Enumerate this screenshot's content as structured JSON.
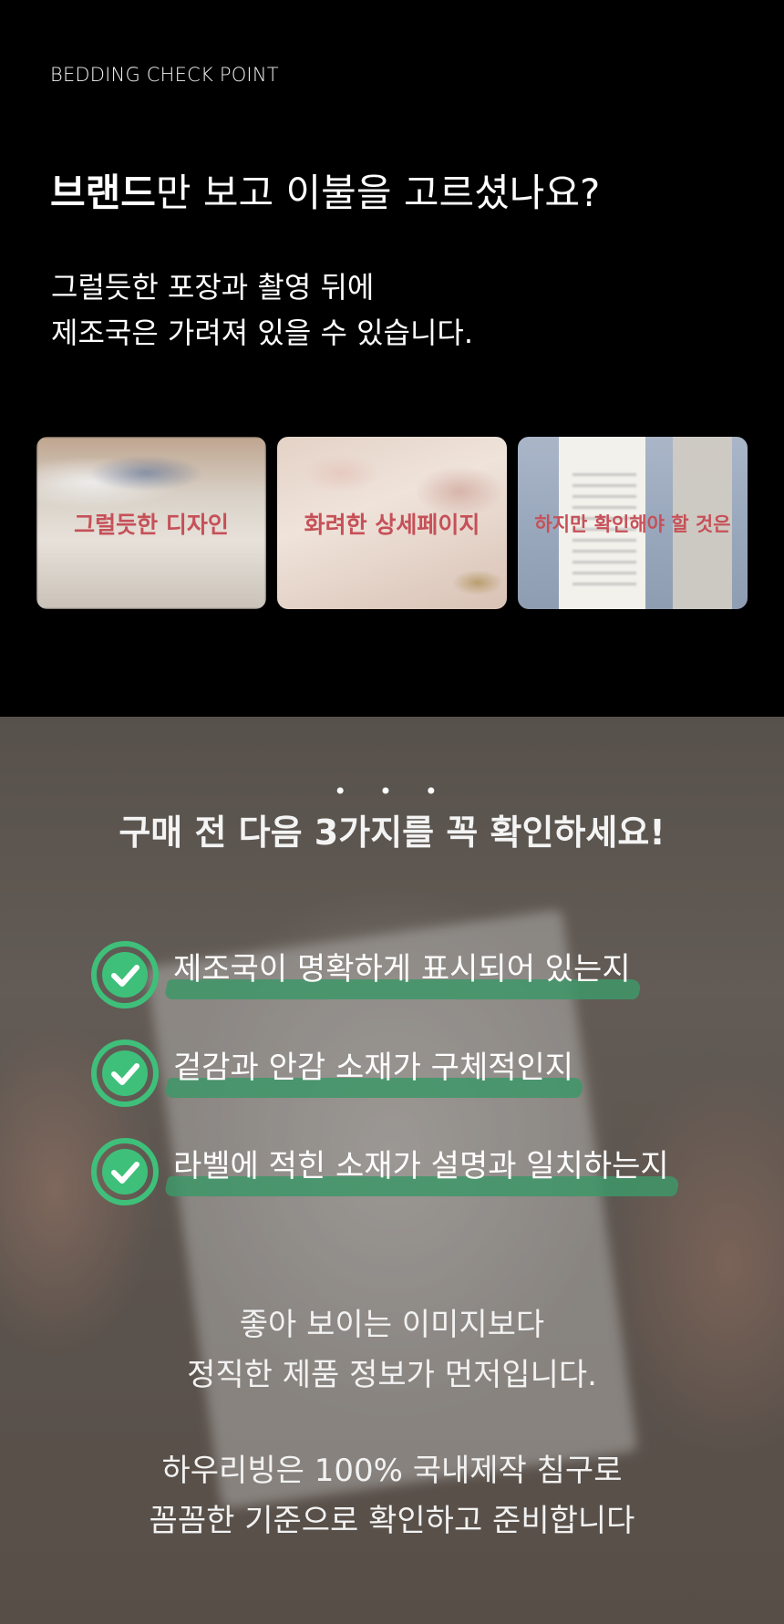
{
  "top": {
    "eyebrow": "BEDDING CHECK POINT",
    "headline_strong": "브랜드",
    "headline_rest": "만 보고 이불을 고르셨나요?",
    "intro_line1": "그럴듯한 포장과 촬영 뒤에",
    "intro_line2": "제조국은 가려져 있을 수 있습니다.",
    "cards": [
      {
        "label": "그럴듯한 디자인"
      },
      {
        "label": "화려한 상세페이지"
      },
      {
        "label": "하지만 확인해야 할 것은"
      }
    ]
  },
  "bottom": {
    "dots": "• • •",
    "subhead": "구매 전 다음 3가지를 꼭 확인하세요!",
    "checklist": [
      {
        "text": "제조국이 명확하게 표시되어 있는지",
        "icon": "check-circle-icon"
      },
      {
        "text": "겉감과 안감 소재가 구체적인지",
        "icon": "check-circle-icon"
      },
      {
        "text": "라벨에 적힌 소재가 설명과 일치하는지",
        "icon": "check-circle-icon"
      }
    ],
    "message_line1": "좋아 보이는 이미지보다",
    "message_line2": "정직한 제품 정보가 먼저입니다.",
    "closing_line1": "하우리빙은 100% 국내제작 침구로",
    "closing_line2": "꼼꼼한 기준으로 확인하고 준비합니다"
  },
  "colors": {
    "accent_green": "#3ec07a",
    "brush_green": "#3e9669",
    "card_label": "#c65058"
  }
}
